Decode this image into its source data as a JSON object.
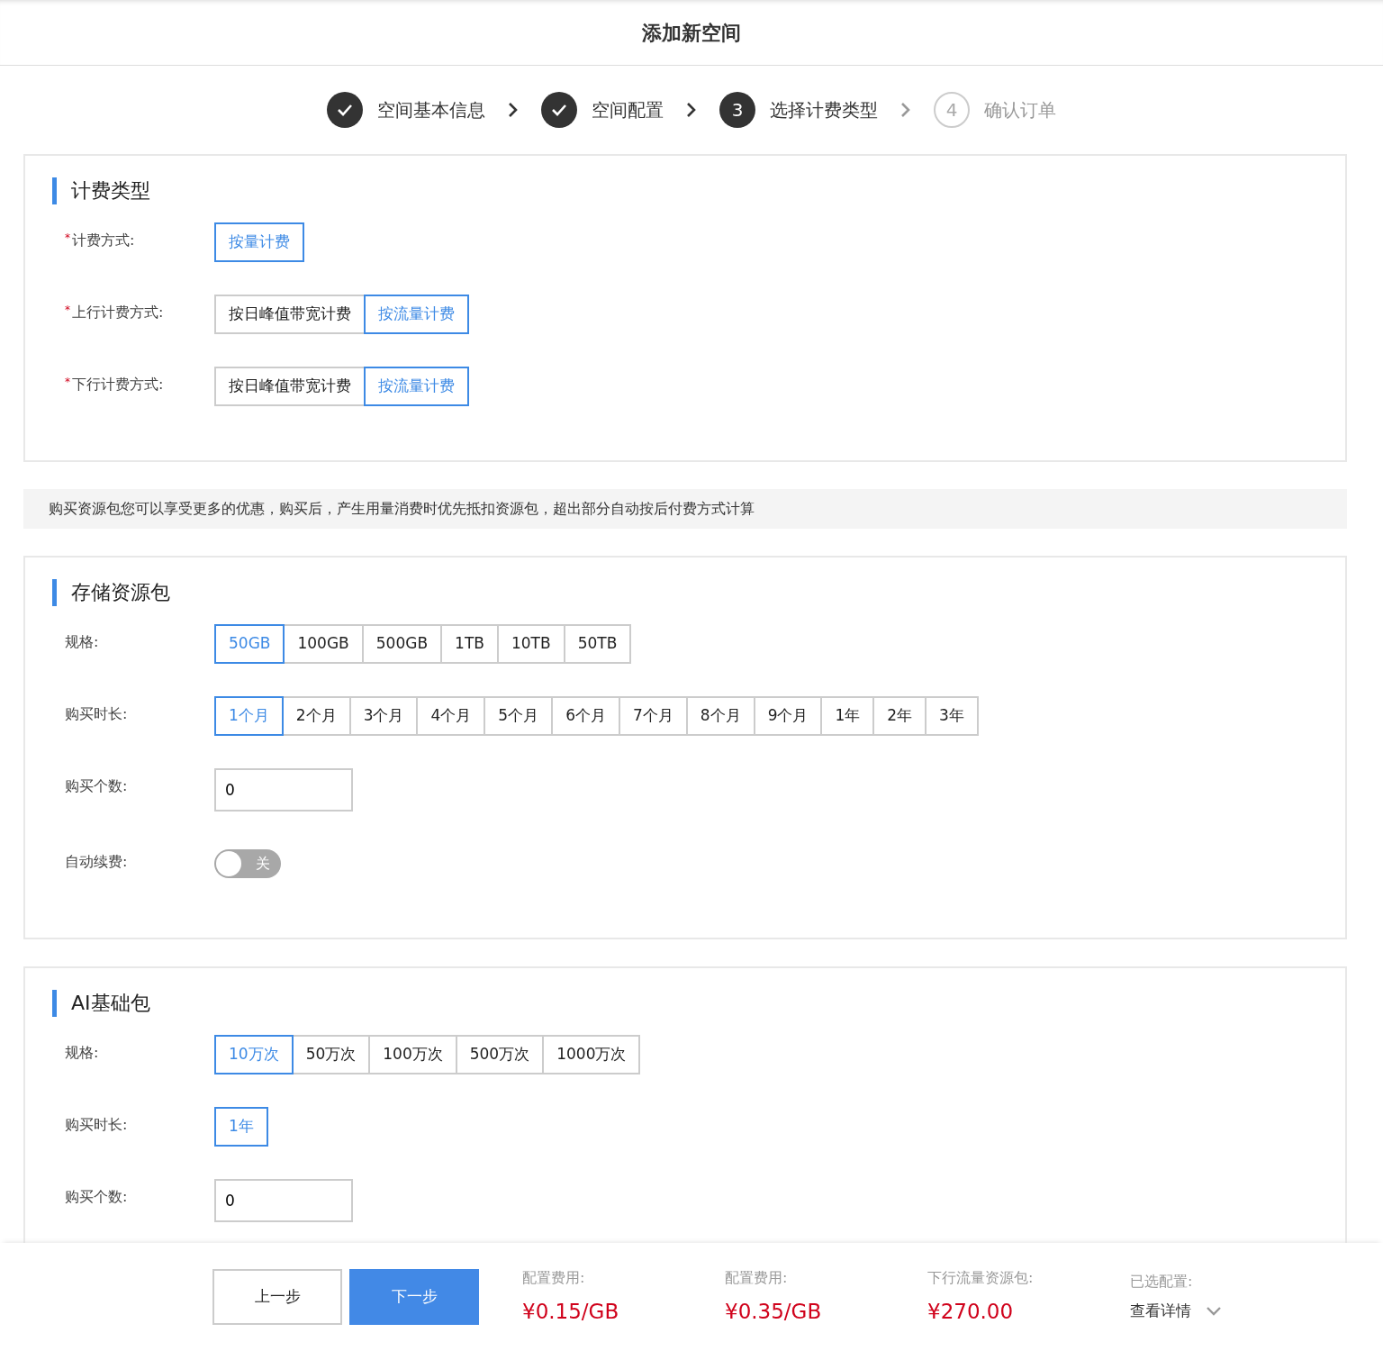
{
  "title": "添加新空间",
  "steps": [
    {
      "label": "空间基本信息",
      "kind": "done"
    },
    {
      "label": "空间配置",
      "kind": "done"
    },
    {
      "label": "选择计费类型",
      "kind": "current",
      "number": "3"
    },
    {
      "label": "确认订单",
      "kind": "todo",
      "number": "4"
    }
  ],
  "sections": [
    {
      "kind": "card",
      "title": "计费类型",
      "fields": [
        {
          "kind": "options",
          "label": "计费方式:",
          "required_mark": "*",
          "options": [
            {
              "label": "按量计费",
              "selected": true
            }
          ]
        },
        {
          "kind": "options",
          "label": "上行计费方式:",
          "required_mark": "*",
          "options": [
            {
              "label": "按日峰值带宽计费",
              "selected": false
            },
            {
              "label": "按流量计费",
              "selected": true
            }
          ]
        },
        {
          "kind": "options",
          "label": "下行计费方式:",
          "required_mark": "*",
          "options": [
            {
              "label": "按日峰值带宽计费",
              "selected": false
            },
            {
              "label": "按流量计费",
              "selected": true
            }
          ]
        }
      ]
    },
    {
      "kind": "notice",
      "text": "购买资源包您可以享受更多的优惠，购买后，产生用量消费时优先抵扣资源包，超出部分自动按后付费方式计算"
    },
    {
      "kind": "card",
      "title": "存储资源包",
      "fields": [
        {
          "kind": "options",
          "label": "规格:",
          "options": [
            {
              "label": "50GB",
              "selected": true
            },
            {
              "label": "100GB",
              "selected": false
            },
            {
              "label": "500GB",
              "selected": false
            },
            {
              "label": "1TB",
              "selected": false
            },
            {
              "label": "10TB",
              "selected": false
            },
            {
              "label": "50TB",
              "selected": false
            }
          ]
        },
        {
          "kind": "options",
          "label": "购买时长:",
          "options": [
            {
              "label": "1个月",
              "selected": true
            },
            {
              "label": "2个月",
              "selected": false
            },
            {
              "label": "3个月",
              "selected": false
            },
            {
              "label": "4个月",
              "selected": false
            },
            {
              "label": "5个月",
              "selected": false
            },
            {
              "label": "6个月",
              "selected": false
            },
            {
              "label": "7个月",
              "selected": false
            },
            {
              "label": "8个月",
              "selected": false
            },
            {
              "label": "9个月",
              "selected": false
            },
            {
              "label": "1年",
              "selected": false
            },
            {
              "label": "2年",
              "selected": false
            },
            {
              "label": "3年",
              "selected": false
            }
          ]
        },
        {
          "kind": "number",
          "label": "购买个数:",
          "value": "0"
        },
        {
          "kind": "switch",
          "label": "自动续费:",
          "on": false,
          "text": "关"
        }
      ]
    },
    {
      "kind": "card",
      "title": "AI基础包",
      "fields": [
        {
          "kind": "options",
          "label": "规格:",
          "options": [
            {
              "label": "10万次",
              "selected": true
            },
            {
              "label": "50万次",
              "selected": false
            },
            {
              "label": "100万次",
              "selected": false
            },
            {
              "label": "500万次",
              "selected": false
            },
            {
              "label": "1000万次",
              "selected": false
            }
          ]
        },
        {
          "kind": "options",
          "label": "购买时长:",
          "options": [
            {
              "label": "1年",
              "selected": true
            }
          ]
        },
        {
          "kind": "number",
          "label": "购买个数:",
          "value": "0"
        }
      ]
    }
  ],
  "footer": {
    "buttons": [
      {
        "label": "上一步",
        "kind": "secondary"
      },
      {
        "label": "下一步",
        "kind": "primary"
      }
    ],
    "costs": [
      {
        "label": "配置费用:",
        "value": "¥0.15/GB"
      },
      {
        "label": "配置费用:",
        "value": "¥0.35/GB"
      },
      {
        "label": "下行流量资源包:",
        "value": "¥270.00"
      }
    ],
    "details": {
      "label": "已选配置:",
      "link": "查看详情"
    }
  }
}
